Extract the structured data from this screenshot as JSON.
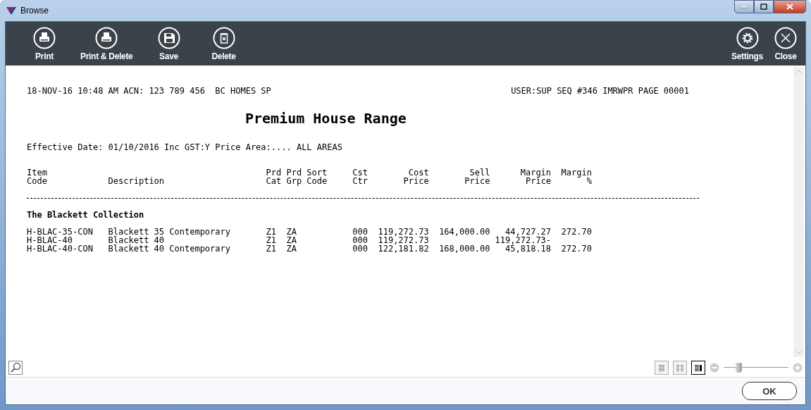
{
  "window": {
    "title": "Browse"
  },
  "toolbar": {
    "left": [
      {
        "label": "Print"
      },
      {
        "label": "Print & Delete"
      },
      {
        "label": "Save"
      },
      {
        "label": "Delete"
      }
    ],
    "right": [
      {
        "label": "Settings"
      },
      {
        "label": "Close"
      }
    ]
  },
  "report": {
    "header_left": "18-NOV-16 10:48 AM ACN: 123 789 456  BC HOMES SP",
    "header_right": "USER:SUP SEQ #346 IMRWPR PAGE 00001",
    "title": "Premium House Range",
    "subtitle": "Effective Date: 01/10/2016 Inc GST:Y Price Area:.... ALL AREAS",
    "columns": [
      {
        "line1": "Item",
        "line2": "Code"
      },
      {
        "line2": "Description"
      },
      {
        "line1": "Prd",
        "line2": "Cat"
      },
      {
        "line1": "Prd",
        "line2": "Grp"
      },
      {
        "line1": "Sort",
        "line2": "Code"
      },
      {
        "line1": "Cst",
        "line2": "Ctr"
      },
      {
        "line1": "Cost",
        "line2": "Price"
      },
      {
        "line1": "Sell",
        "line2": "Price"
      },
      {
        "line1": "Margin",
        "line2": "Price"
      },
      {
        "line1": "Margin",
        "line2": "%"
      }
    ],
    "group": "The Blackett Collection",
    "rows": [
      {
        "cells": [
          "H-BLAC-35-CON",
          "Blackett 35 Contemporary",
          "Z1",
          "ZA",
          null,
          "000",
          "119,272.73",
          "164,000.00",
          "44,727.27",
          "272.70"
        ]
      },
      {
        "cells": [
          "H-BLAC-40",
          "Blackett 40",
          "Z1",
          "ZA",
          null,
          "000",
          "119,272.73",
          null,
          "119,272.73-",
          null
        ]
      },
      {
        "cells": [
          "H-BLAC-40-CON",
          "Blackett 40 Contemporary",
          "Z1",
          "ZA",
          null,
          "000",
          "122,181.82",
          "168,000.00",
          "45,818.18",
          "272.70"
        ]
      }
    ]
  },
  "view_modes": [
    {
      "selected": false
    },
    {
      "selected": false
    },
    {
      "selected": true
    }
  ],
  "zoom": {
    "level": 0.23
  },
  "buttons": [
    "OK"
  ]
}
